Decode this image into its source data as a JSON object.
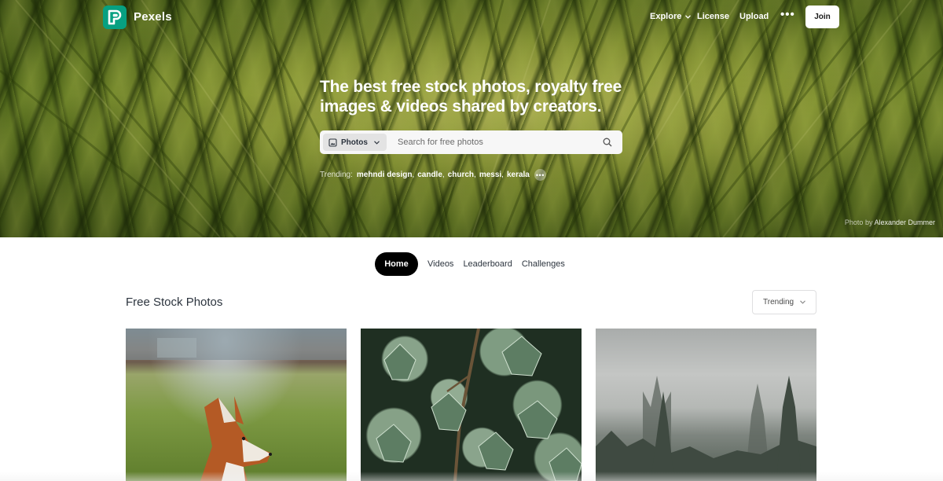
{
  "nav": {
    "brand": "Pexels",
    "explore": "Explore",
    "license": "License",
    "upload": "Upload",
    "more": "•••",
    "join": "Join"
  },
  "hero": {
    "headline": "The best free stock photos, royalty free images & videos shared by creators.",
    "search": {
      "type_label": "Photos",
      "placeholder": "Search for free photos"
    },
    "trending_label": "Trending:",
    "trending": [
      "mehndi design",
      "candle",
      "church",
      "messi",
      "kerala"
    ],
    "credit_prefix": "Photo by",
    "credit_author": "Alexander Dummer"
  },
  "tabs": [
    "Home",
    "Videos",
    "Leaderboard",
    "Challenges"
  ],
  "section": {
    "title": "Free Stock Photos",
    "sort": "Trending"
  },
  "colors": {
    "brand": "#07a081",
    "active_tab": "#000000"
  },
  "icons": [
    "pexels-logo-icon",
    "chevron-down-icon",
    "image-icon",
    "search-icon",
    "more-icon"
  ]
}
